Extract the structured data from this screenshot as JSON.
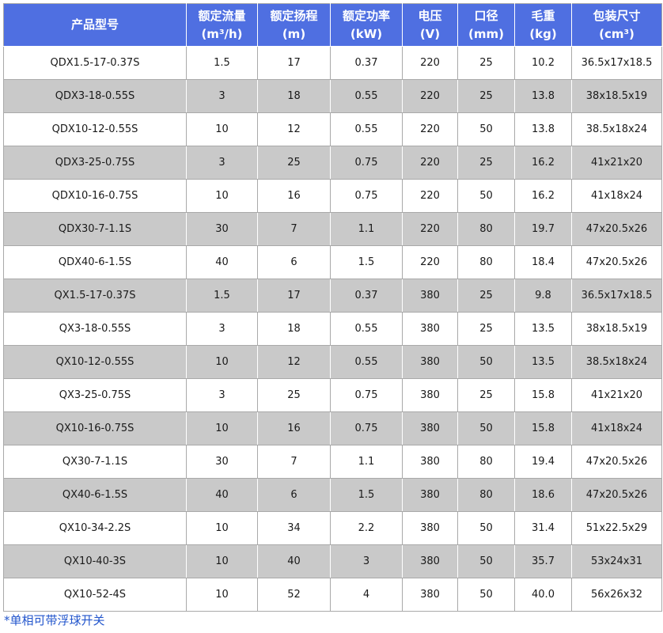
{
  "colors": {
    "header_bg": "#4f6fe1",
    "header_text": "#ffffff",
    "row_alt_bg": "#c9c9c9",
    "footnote_text": "#2255cc"
  },
  "table": {
    "headers": [
      {
        "label": "产品型号"
      },
      {
        "label": "额定流量",
        "unit": "(m³/h)"
      },
      {
        "label": "额定扬程",
        "unit": "(m)"
      },
      {
        "label": "额定功率",
        "unit": "(kW)"
      },
      {
        "label": "电压",
        "unit": "(V)"
      },
      {
        "label": "口径",
        "unit": "(mm)"
      },
      {
        "label": "毛重",
        "unit": "(kg)"
      },
      {
        "label": "包装尺寸",
        "unit": "(cm³)"
      }
    ],
    "rows": [
      [
        "QDX1.5-17-0.37S",
        "1.5",
        "17",
        "0.37",
        "220",
        "25",
        "10.2",
        "36.5x17x18.5"
      ],
      [
        "QDX3-18-0.55S",
        "3",
        "18",
        "0.55",
        "220",
        "25",
        "13.8",
        "38x18.5x19"
      ],
      [
        "QDX10-12-0.55S",
        "10",
        "12",
        "0.55",
        "220",
        "50",
        "13.8",
        "38.5x18x24"
      ],
      [
        "QDX3-25-0.75S",
        "3",
        "25",
        "0.75",
        "220",
        "25",
        "16.2",
        "41x21x20"
      ],
      [
        "QDX10-16-0.75S",
        "10",
        "16",
        "0.75",
        "220",
        "50",
        "16.2",
        "41x18x24"
      ],
      [
        "QDX30-7-1.1S",
        "30",
        "7",
        "1.1",
        "220",
        "80",
        "19.7",
        "47x20.5x26"
      ],
      [
        "QDX40-6-1.5S",
        "40",
        "6",
        "1.5",
        "220",
        "80",
        "18.4",
        "47x20.5x26"
      ],
      [
        "QX1.5-17-0.37S",
        "1.5",
        "17",
        "0.37",
        "380",
        "25",
        "9.8",
        "36.5x17x18.5"
      ],
      [
        "QX3-18-0.55S",
        "3",
        "18",
        "0.55",
        "380",
        "25",
        "13.5",
        "38x18.5x19"
      ],
      [
        "QX10-12-0.55S",
        "10",
        "12",
        "0.55",
        "380",
        "50",
        "13.5",
        "38.5x18x24"
      ],
      [
        "QX3-25-0.75S",
        "3",
        "25",
        "0.75",
        "380",
        "25",
        "15.8",
        "41x21x20"
      ],
      [
        "QX10-16-0.75S",
        "10",
        "16",
        "0.75",
        "380",
        "50",
        "15.8",
        "41x18x24"
      ],
      [
        "QX30-7-1.1S",
        "30",
        "7",
        "1.1",
        "380",
        "80",
        "19.4",
        "47x20.5x26"
      ],
      [
        "QX40-6-1.5S",
        "40",
        "6",
        "1.5",
        "380",
        "80",
        "18.6",
        "47x20.5x26"
      ],
      [
        "QX10-34-2.2S",
        "10",
        "34",
        "2.2",
        "380",
        "50",
        "31.4",
        "51x22.5x29"
      ],
      [
        "QX10-40-3S",
        "10",
        "40",
        "3",
        "380",
        "50",
        "35.7",
        "53x24x31"
      ],
      [
        "QX10-52-4S",
        "10",
        "52",
        "4",
        "380",
        "50",
        "40.0",
        "56x26x32"
      ]
    ]
  },
  "footnote": "*单相可带浮球开关"
}
